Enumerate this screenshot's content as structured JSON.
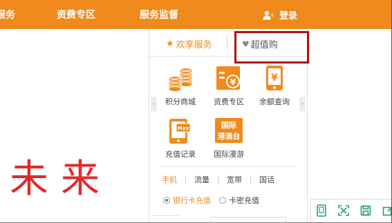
{
  "nav": {
    "items": [
      "服务",
      "资费专区",
      "服务监督"
    ],
    "login_label": "登录"
  },
  "headline": "未来",
  "panel": {
    "tabs": [
      "欢享服务",
      "超值购"
    ],
    "services": [
      {
        "label": "积分商城",
        "icon": "coins-icon"
      },
      {
        "label": "资费专区",
        "icon": "yen-tag-icon"
      },
      {
        "label": "余额查询",
        "icon": "phone-yen-icon"
      },
      {
        "label": "充值记录",
        "icon": "phone-max-icon"
      },
      {
        "label": "国际漫游",
        "icon": "intl-roaming-icon",
        "badge": [
          "国际",
          "港澳台"
        ]
      }
    ],
    "subtabs": [
      "手机",
      "流量",
      "宽带",
      "国话"
    ],
    "radios": [
      {
        "label": "银行卡充值",
        "checked": true
      },
      {
        "label": "卡密充值",
        "checked": false
      }
    ]
  },
  "colors": {
    "brand_orange": "#f08a1c",
    "headline_red": "#e02a2a",
    "highlight_border": "#a51515"
  },
  "tools": [
    "phone-frame-icon",
    "fit-screen-icon",
    "save-icon",
    "edit-icon"
  ]
}
